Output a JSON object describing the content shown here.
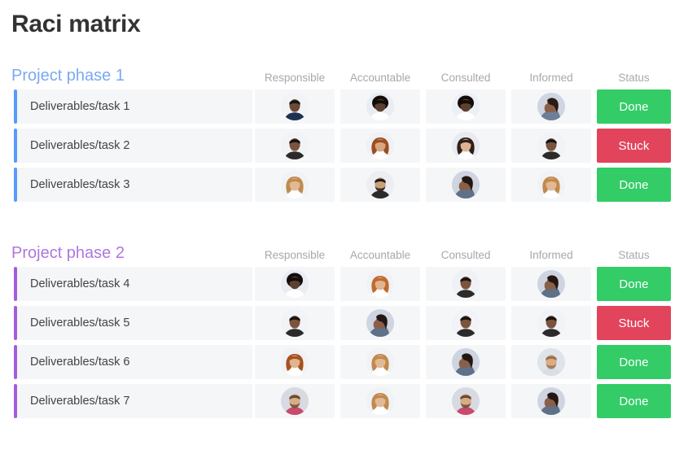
{
  "page": {
    "title": "Raci matrix"
  },
  "columns": {
    "responsible": "Responsible",
    "accountable": "Accountable",
    "consulted": "Consulted",
    "informed": "Informed",
    "status": "Status"
  },
  "colors": {
    "phase1_accent": "#579bfc",
    "phase1_title": "#7ba9f0",
    "phase2_accent": "#a25ddc",
    "phase2_title": "#b077dd",
    "status_done": "#33cc66",
    "status_stuck": "#e2445c",
    "row_background": "#f5f6f8",
    "title_text": "#333333",
    "header_text": "#a8a8ac"
  },
  "sections": [
    {
      "title": "Project phase 1",
      "accent": "blue",
      "rows": [
        {
          "label": "Deliverables/task 1",
          "status": "Done",
          "status_kind": "done",
          "avatars": [
            {
              "name": "avatar-responsible",
              "skin": "#6b4a35",
              "hair": "#1c1410",
              "shirt": "#1f3050",
              "bg": "#f2f3f7",
              "style": "short"
            },
            {
              "name": "avatar-accountable",
              "skin": "#5e4030",
              "hair": "#120d0a",
              "shirt": "#ffffff",
              "bg": "#e9ecf3",
              "style": "afro"
            },
            {
              "name": "avatar-consulted",
              "skin": "#5e4030",
              "hair": "#120d0a",
              "shirt": "#ffffff",
              "bg": "#eceff5",
              "style": "afro"
            },
            {
              "name": "avatar-informed",
              "skin": "#8a5f48",
              "hair": "#2a1c14",
              "shirt": "#6d7f98",
              "bg": "#cfd6e2",
              "style": "facepalm"
            }
          ]
        },
        {
          "label": "Deliverables/task 2",
          "status": "Stuck",
          "status_kind": "stuck",
          "avatars": [
            {
              "name": "avatar-responsible",
              "skin": "#7a543c",
              "hair": "#1a1310",
              "shirt": "#2b2b2b",
              "bg": "#f2f3f7",
              "style": "short"
            },
            {
              "name": "avatar-accountable",
              "skin": "#d9a77f",
              "hair": "#9b4f22",
              "shirt": "#ffffff",
              "bg": "#f0f1f5",
              "style": "long"
            },
            {
              "name": "avatar-consulted",
              "skin": "#e0b294",
              "hair": "#2e2119",
              "shirt": "#ffffff",
              "bg": "#e8eaf0",
              "style": "long"
            },
            {
              "name": "avatar-informed",
              "skin": "#7a543c",
              "hair": "#1a1310",
              "shirt": "#2b2b2b",
              "bg": "#f2f3f7",
              "style": "short"
            }
          ]
        },
        {
          "label": "Deliverables/task 3",
          "status": "Done",
          "status_kind": "done",
          "avatars": [
            {
              "name": "avatar-responsible",
              "skin": "#e3b894",
              "hair": "#c08a4e",
              "shirt": "#ffffff",
              "bg": "#f1f2f6",
              "style": "long"
            },
            {
              "name": "avatar-accountable",
              "skin": "#caa078",
              "hair": "#241a14",
              "shirt": "#2b2b2b",
              "bg": "#eceef4",
              "style": "beard"
            },
            {
              "name": "avatar-consulted",
              "skin": "#8a5f48",
              "hair": "#241713",
              "shirt": "#5f7189",
              "bg": "#ced5e1",
              "style": "facepalm"
            },
            {
              "name": "avatar-informed",
              "skin": "#e3b894",
              "hair": "#c08a4e",
              "shirt": "#ffffff",
              "bg": "#f1f2f6",
              "style": "long"
            }
          ]
        }
      ]
    },
    {
      "title": "Project phase 2",
      "accent": "purple",
      "rows": [
        {
          "label": "Deliverables/task 4",
          "status": "Done",
          "status_kind": "done",
          "avatars": [
            {
              "name": "avatar-responsible",
              "skin": "#5e4030",
              "hair": "#120d0a",
              "shirt": "#ffffff",
              "bg": "#e9ecf3",
              "style": "afro"
            },
            {
              "name": "avatar-accountable",
              "skin": "#e0b48e",
              "hair": "#c06a2e",
              "shirt": "#ffffff",
              "bg": "#f1f2f6",
              "style": "long"
            },
            {
              "name": "avatar-consulted",
              "skin": "#7a543c",
              "hair": "#1a1310",
              "shirt": "#2b2b2b",
              "bg": "#f0f1f5",
              "style": "short"
            },
            {
              "name": "avatar-informed",
              "skin": "#8a5f48",
              "hair": "#241713",
              "shirt": "#5f7189",
              "bg": "#ced5e1",
              "style": "facepalm"
            }
          ]
        },
        {
          "label": "Deliverables/task 5",
          "status": "Stuck",
          "status_kind": "stuck",
          "avatars": [
            {
              "name": "avatar-responsible",
              "skin": "#7a543c",
              "hair": "#1a1310",
              "shirt": "#2b2b2b",
              "bg": "#f2f3f7",
              "style": "short"
            },
            {
              "name": "avatar-accountable",
              "skin": "#8a5f48",
              "hair": "#241713",
              "shirt": "#5f7189",
              "bg": "#ced5e1",
              "style": "facepalm"
            },
            {
              "name": "avatar-consulted",
              "skin": "#7a543c",
              "hair": "#1a1310",
              "shirt": "#2b2b2b",
              "bg": "#f2f3f7",
              "style": "short"
            },
            {
              "name": "avatar-informed",
              "skin": "#7a543c",
              "hair": "#1a1310",
              "shirt": "#2b2b2b",
              "bg": "#f2f3f7",
              "style": "short"
            }
          ]
        },
        {
          "label": "Deliverables/task 6",
          "status": "Done",
          "status_kind": "done",
          "avatars": [
            {
              "name": "avatar-responsible",
              "skin": "#e0b48e",
              "hair": "#a8501f",
              "shirt": "#ffffff",
              "bg": "#f1f2f6",
              "style": "long"
            },
            {
              "name": "avatar-accountable",
              "skin": "#e3b894",
              "hair": "#c08a4e",
              "shirt": "#ffffff",
              "bg": "#f1f2f6",
              "style": "long"
            },
            {
              "name": "avatar-consulted",
              "skin": "#8a5f48",
              "hair": "#241713",
              "shirt": "#5f7189",
              "bg": "#ced5e1",
              "style": "facepalm"
            },
            {
              "name": "avatar-informed",
              "skin": "#d9ab86",
              "hair": "#9a7246",
              "shirt": "#d8dde6",
              "bg": "#dfe3ea",
              "style": "beard"
            }
          ]
        },
        {
          "label": "Deliverables/task 7",
          "status": "Done",
          "status_kind": "done",
          "avatars": [
            {
              "name": "avatar-responsible",
              "skin": "#d9ab86",
              "hair": "#6a4a32",
              "shirt": "#c94a6a",
              "bg": "#d7dae1",
              "style": "beard"
            },
            {
              "name": "avatar-accountable",
              "skin": "#e3b894",
              "hair": "#c08a4e",
              "shirt": "#ffffff",
              "bg": "#f1f2f6",
              "style": "long"
            },
            {
              "name": "avatar-consulted",
              "skin": "#d9ab86",
              "hair": "#6a4a32",
              "shirt": "#c94a6a",
              "bg": "#d7dae1",
              "style": "beard"
            },
            {
              "name": "avatar-informed",
              "skin": "#8a5f48",
              "hair": "#241713",
              "shirt": "#5f7189",
              "bg": "#ced5e1",
              "style": "facepalm"
            }
          ]
        }
      ]
    }
  ]
}
